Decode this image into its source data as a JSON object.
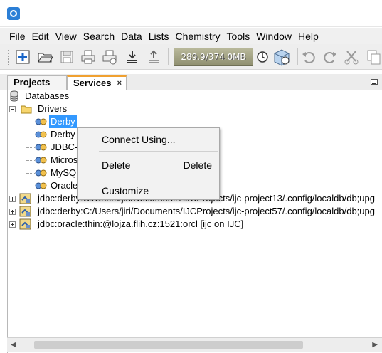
{
  "menubar": {
    "items": [
      "File",
      "Edit",
      "View",
      "Search",
      "Data",
      "Lists",
      "Chemistry",
      "Tools",
      "Window",
      "Help"
    ]
  },
  "toolbar": {
    "memory": "289.9/374.0MB",
    "icons": [
      "new-icon",
      "open-icon",
      "save-icon",
      "print-icon",
      "print-setup-icon",
      "import-icon",
      "export-icon",
      "gc-icon",
      "plugin-icon",
      "undo-icon",
      "redo-icon",
      "cut-icon",
      "copy-icon"
    ]
  },
  "tabs": {
    "projects": "Projects",
    "services": "Services",
    "close_glyph": "×"
  },
  "tree": {
    "databases": "Databases",
    "drivers": "Drivers",
    "driver_items": [
      "Derby",
      "Derby",
      "JDBC-C",
      "Micros",
      "MySQL",
      "Oracle"
    ],
    "connections": [
      "jdbc:derby:C:/Users/jiri/Documents/IJCProjects/ijc-project13/.config/localdb/db;upg",
      "jdbc:derby:C:/Users/jiri/Documents/IJCProjects/ijc-project57/.config/localdb/db;upg",
      "jdbc:oracle:thin:@lojza.flih.cz:1521:orcl [ijc on IJC]"
    ]
  },
  "context_menu": {
    "connect": "Connect Using...",
    "delete": "Delete",
    "delete_shortcut": "Delete",
    "customize": "Customize"
  },
  "colors": {
    "selection": "#3399ff",
    "active_tab_accent": "#f0a030"
  }
}
